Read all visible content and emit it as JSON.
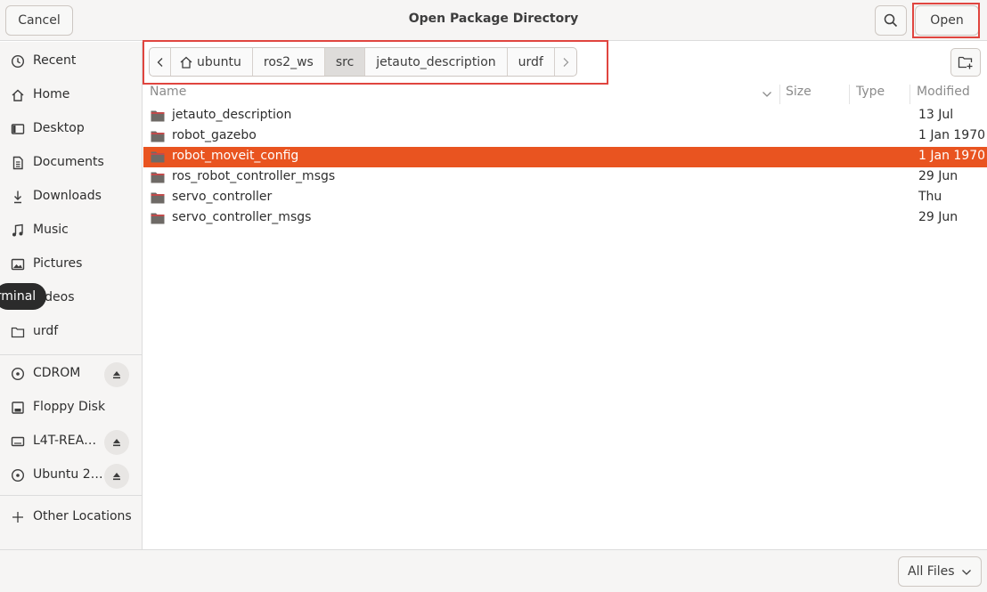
{
  "dialog": {
    "title": "Open Package Directory"
  },
  "header": {
    "cancel_label": "Cancel",
    "open_label": "Open",
    "search_icon": "search-icon"
  },
  "sidebar": {
    "places": [
      {
        "label": "Recent",
        "icon": "clock-icon"
      },
      {
        "label": "Home",
        "icon": "home-icon"
      },
      {
        "label": "Desktop",
        "icon": "desktop-icon"
      },
      {
        "label": "Documents",
        "icon": "document-icon"
      },
      {
        "label": "Downloads",
        "icon": "download-icon"
      },
      {
        "label": "Music",
        "icon": "music-icon"
      },
      {
        "label": "Pictures",
        "icon": "picture-icon"
      },
      {
        "label": "Videos",
        "icon": "video-icon"
      },
      {
        "label": "urdf",
        "icon": "folder-icon"
      }
    ],
    "devices": [
      {
        "label": "CDROM",
        "icon": "disc-icon",
        "eject": true
      },
      {
        "label": "Floppy Disk",
        "icon": "floppy-icon",
        "eject": false
      },
      {
        "label": "L4T-REA…",
        "icon": "drive-icon",
        "eject": true
      },
      {
        "label": "Ubuntu 2…",
        "icon": "disc-icon",
        "eject": true
      }
    ],
    "other_locations": "Other Locations"
  },
  "tooltip": "Terminal",
  "pathbar": {
    "crumbs": [
      "ubuntu",
      "ros2_ws",
      "src",
      "jetauto_description",
      "urdf"
    ],
    "active": "src"
  },
  "columns": {
    "name": "Name",
    "size": "Size",
    "type": "Type",
    "modified": "Modified"
  },
  "files": [
    {
      "name": "jetauto_description",
      "modified": "13 Jul",
      "selected": false
    },
    {
      "name": "robot_gazebo",
      "modified": "1 Jan 1970",
      "selected": false
    },
    {
      "name": "robot_moveit_config",
      "modified": "1 Jan 1970",
      "selected": true
    },
    {
      "name": "ros_robot_controller_msgs",
      "modified": "29 Jun",
      "selected": false
    },
    {
      "name": "servo_controller",
      "modified": "Thu",
      "selected": false
    },
    {
      "name": "servo_controller_msgs",
      "modified": "29 Jun",
      "selected": false
    }
  ],
  "footer": {
    "filter_label": "All Files"
  },
  "colors": {
    "accent": "#e95420",
    "highlight_box": "#e0453f"
  }
}
